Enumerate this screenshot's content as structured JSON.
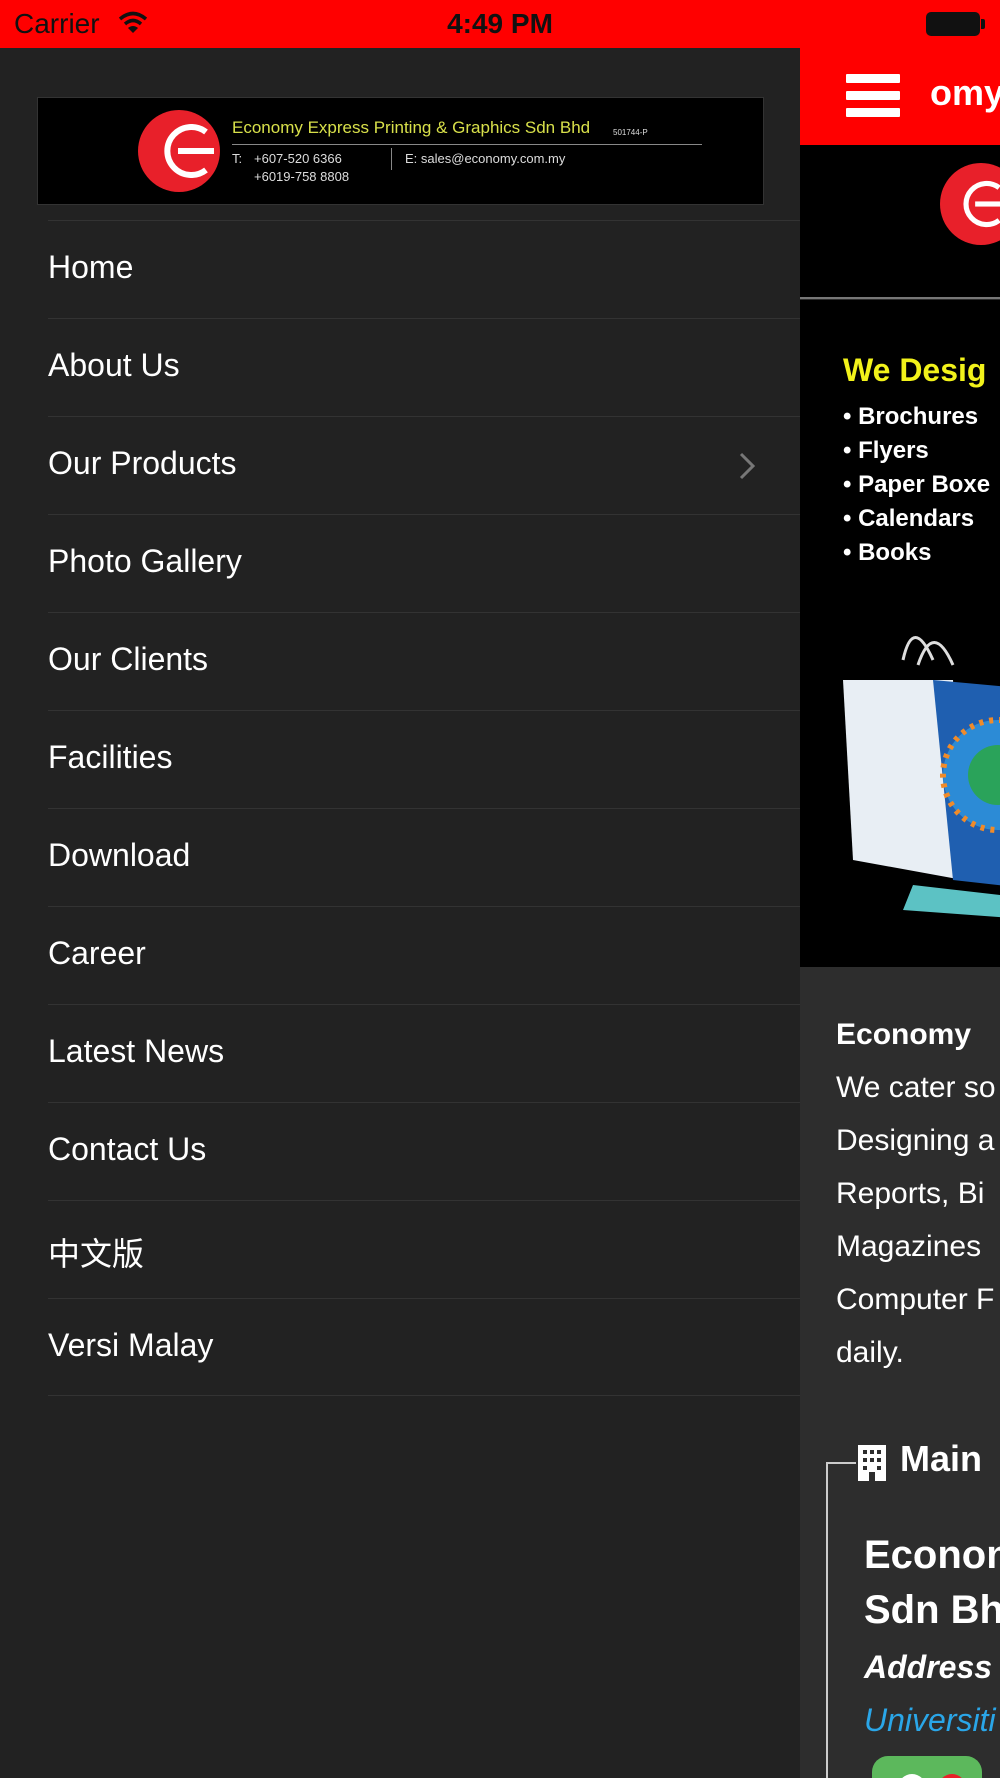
{
  "status_bar": {
    "carrier": "Carrier",
    "time": "4:49 PM"
  },
  "menu": {
    "logo": {
      "company": "Economy Express Printing & Graphics Sdn Bhd",
      "reg_no": "501744-P",
      "phone_label": "T:",
      "phone1": "+607-520 6366",
      "phone2": "+6019-758 8808",
      "email": "E: sales@economy.com.my"
    },
    "items": [
      {
        "label": "Home"
      },
      {
        "label": "About Us"
      },
      {
        "label": "Our Products",
        "has_submenu": true
      },
      {
        "label": "Photo Gallery"
      },
      {
        "label": "Our Clients"
      },
      {
        "label": "Facilities"
      },
      {
        "label": "Download"
      },
      {
        "label": "Career"
      },
      {
        "label": "Latest News"
      },
      {
        "label": "Contact Us"
      },
      {
        "label": "中文版"
      },
      {
        "label": "Versi Malay"
      }
    ]
  },
  "main": {
    "header_title": "omy",
    "promo": {
      "title": "We Desig",
      "items": [
        "• Brochures",
        "• Flyers",
        "• Paper Boxe",
        "• Calendars",
        "• Books"
      ]
    },
    "about": {
      "heading": "Economy",
      "lines": [
        "We cater so",
        "Designing a",
        "Reports, Bi",
        "Magazines",
        "Computer F",
        "daily."
      ]
    },
    "section_heading": "Main",
    "company_lines": [
      "Econon",
      "Sdn Bh"
    ],
    "address_label": "Address",
    "address_link": "Universiti"
  },
  "colors": {
    "brand_red": "#ff0000",
    "menu_bg": "#222222",
    "link_blue": "#2aa6e8",
    "promo_yellow": "#f2f21a"
  }
}
